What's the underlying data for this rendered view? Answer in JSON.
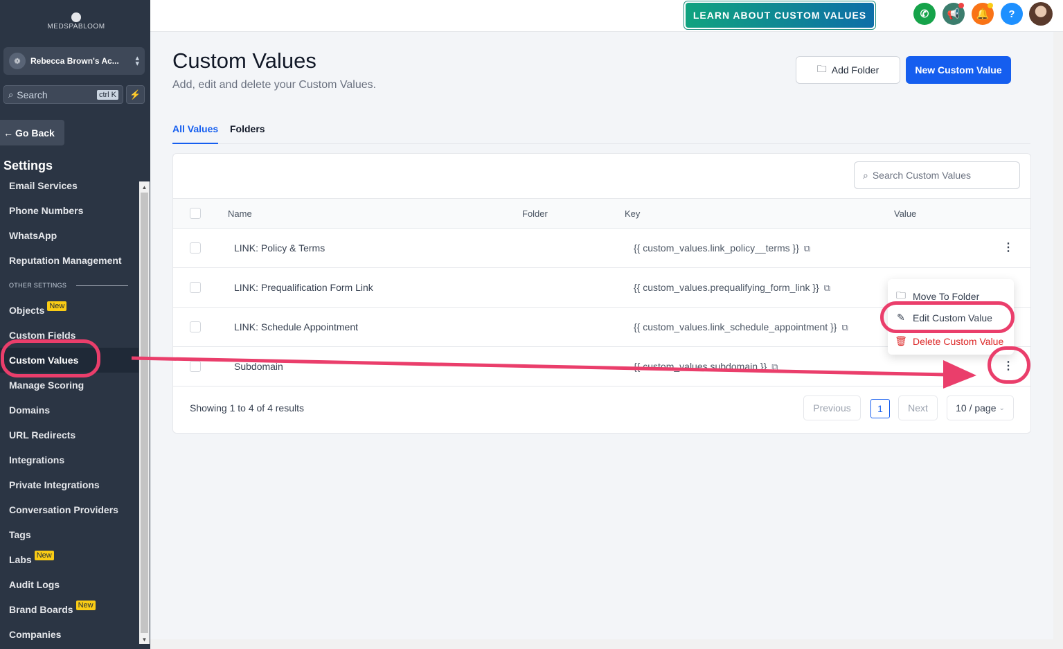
{
  "brand": {
    "logo_text": "MEDSPABLOOM"
  },
  "account": {
    "name": "Rebecca Brown's Ac...",
    "avatar_glyph": "❁"
  },
  "sidebar_search": {
    "placeholder": "Search",
    "shortcut": "ctrl K"
  },
  "go_back": {
    "label": "Go Back"
  },
  "settings_heading": "Settings",
  "nav": {
    "items_top": [
      {
        "label": "Email Services"
      },
      {
        "label": "Phone Numbers"
      },
      {
        "label": "WhatsApp"
      },
      {
        "label": "Reputation Management"
      }
    ],
    "other_heading": "OTHER SETTINGS",
    "items_bottom": [
      {
        "label": "Objects",
        "badge": "New"
      },
      {
        "label": "Custom Fields"
      },
      {
        "label": "Custom Values"
      },
      {
        "label": "Manage Scoring"
      },
      {
        "label": "Domains"
      },
      {
        "label": "URL Redirects"
      },
      {
        "label": "Integrations"
      },
      {
        "label": "Private Integrations"
      },
      {
        "label": "Conversation Providers"
      },
      {
        "label": "Tags"
      },
      {
        "label": "Labs",
        "badge": "New"
      },
      {
        "label": "Audit Logs"
      },
      {
        "label": "Brand Boards",
        "badge": "New"
      },
      {
        "label": "Companies"
      }
    ]
  },
  "header": {
    "learn_button": "LEARN ABOUT CUSTOM VALUES",
    "icons": [
      "phone-icon",
      "megaphone-icon",
      "bell-icon",
      "help-icon"
    ],
    "help_glyph": "?",
    "colors": {
      "phone": "#16a34a",
      "megaphone": "#3b7d6d",
      "bell": "#f97316",
      "help": "#1e90ff"
    }
  },
  "page": {
    "title": "Custom Values",
    "subtitle": "Add, edit and delete your Custom Values.",
    "add_folder_label": "Add Folder",
    "new_value_label": "New Custom Value",
    "accent": "#155eef"
  },
  "tabs": [
    {
      "label": "All Values"
    },
    {
      "label": "Folders"
    }
  ],
  "table": {
    "search_placeholder": "Search Custom Values",
    "columns": {
      "name": "Name",
      "folder": "Folder",
      "key": "Key",
      "value": "Value"
    },
    "rows": [
      {
        "name": "LINK: Policy & Terms",
        "key": "{{ custom_values.link_policy__terms }}"
      },
      {
        "name": "LINK: Prequalification Form Link",
        "key": "{{ custom_values.prequalifying_form_link }}"
      },
      {
        "name": "LINK: Schedule Appointment",
        "key": "{{ custom_values.link_schedule_appointment }}"
      },
      {
        "name": "Subdomain",
        "key": "{{ custom_values.subdomain }}"
      }
    ],
    "footer": "Showing 1 to 4 of 4 results",
    "pagination": {
      "previous": "Previous",
      "page": "1",
      "next": "Next",
      "page_size": "10 / page"
    }
  },
  "row_menu": {
    "move": "Move To Folder",
    "edit": "Edit Custom Value",
    "delete": "Delete Custom Value"
  },
  "annotation_color": "#ea3e6b"
}
